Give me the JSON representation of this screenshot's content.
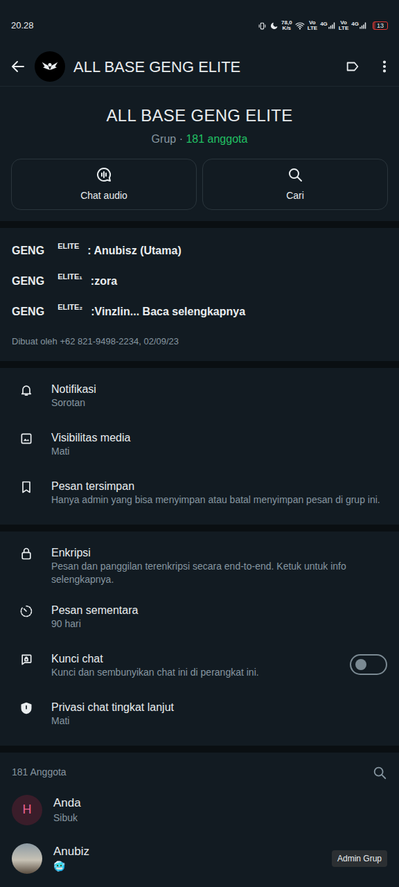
{
  "status_bar": {
    "time": "20.28",
    "speed": "78,0",
    "speed_unit": "K/s",
    "networks": [
      {
        "voice": "Vo",
        "tech": "LTE",
        "gen": "4G"
      },
      {
        "voice": "Vo",
        "tech": "LTE",
        "gen": "4G"
      }
    ],
    "battery": "13",
    "battery_level": 0.13
  },
  "header": {
    "title": "ALL BASE GENG ELITE"
  },
  "group": {
    "name": "ALL BASE GENG ELITE",
    "type": "Grup ·",
    "count": "181 anggota"
  },
  "actions": [
    {
      "label": "Chat audio"
    },
    {
      "label": "Cari"
    }
  ],
  "description": {
    "lines": [
      {
        "prefix": "GENG",
        "sup": "ELITE",
        "text": ": Anubisz (Utama)"
      },
      {
        "prefix": "GENG",
        "sup": "ELITE₁",
        "text": ":zora"
      },
      {
        "prefix": "GENG",
        "sup": "ELITE₂",
        "text": ":Vinzlin..."
      }
    ],
    "more": "Baca selengkapnya",
    "created": "Dibuat oleh +62 821-9498-2234, 02/09/23"
  },
  "settings_groups": [
    [
      {
        "kind": "plain",
        "title": "Notifikasi",
        "subtitle": "Sorotan"
      },
      {
        "kind": "plain",
        "title": "Visibilitas media",
        "subtitle": "Mati"
      },
      {
        "kind": "plain",
        "title": "Pesan tersimpan",
        "subtitle": "Hanya admin yang bisa menyimpan atau batal menyimpan pesan di grup ini."
      }
    ],
    [
      {
        "kind": "plain",
        "title": "Enkripsi",
        "subtitle": "Pesan dan panggilan terenkripsi secara end-to-end. Ketuk untuk info selengkapnya."
      },
      {
        "kind": "plain",
        "title": "Pesan sementara",
        "subtitle": "90 hari"
      },
      {
        "kind": "toggle",
        "title": "Kunci chat",
        "subtitle": "Kunci dan sembunyikan chat ini di perangkat ini.",
        "on": false
      },
      {
        "kind": "plain",
        "title": "Privasi chat tingkat lanjut",
        "subtitle": "Mati"
      }
    ]
  ],
  "members": {
    "header": "181 Anggota",
    "items": [
      {
        "kind": "letter",
        "initial": "H",
        "name": "Anda",
        "status": "Sibuk"
      },
      {
        "kind": "photo",
        "name": "Anubiz",
        "status": "🥶",
        "badge": "Admin Grup"
      },
      {
        "kind": "photo"
      }
    ]
  }
}
